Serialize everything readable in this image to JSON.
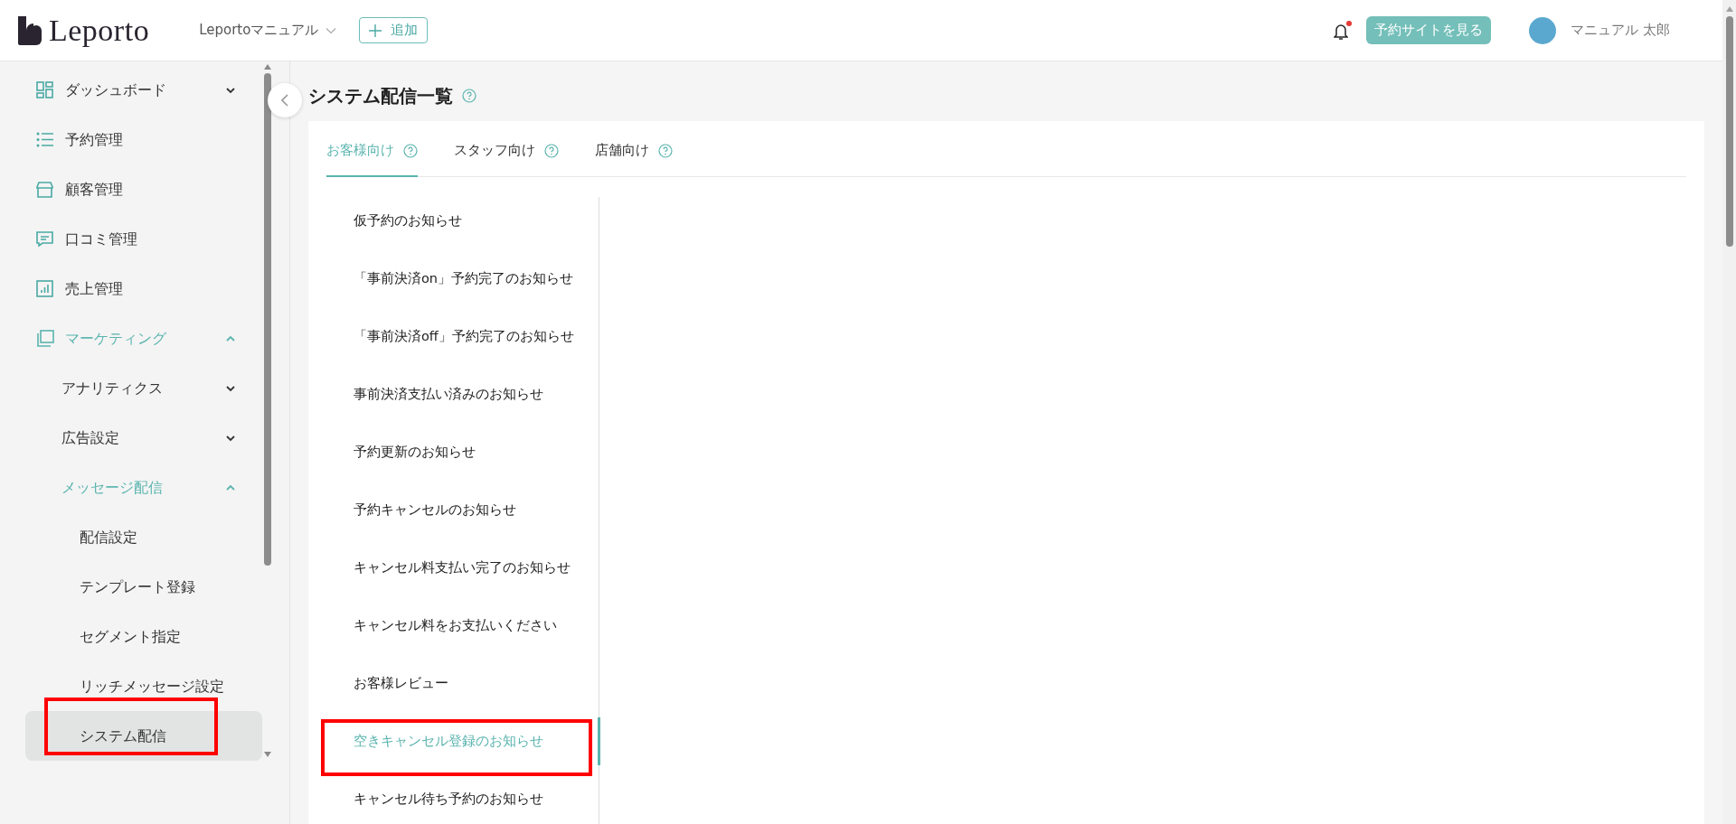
{
  "header": {
    "logo": "Leporto",
    "workspace": "Leportoマニュアル",
    "add_button": "追加",
    "notification_unread": true,
    "site_button": "予約サイトを見る",
    "user_name": "マニュアル 太郎"
  },
  "sidebar": {
    "items": [
      {
        "label": "ダッシュボード",
        "kind": "dashboard",
        "expanded": false,
        "highlighted": false
      },
      {
        "label": "予約管理",
        "kind": "list",
        "highlighted": false
      },
      {
        "label": "顧客管理",
        "kind": "store",
        "highlighted": false
      },
      {
        "label": "口コミ管理",
        "kind": "chat",
        "highlighted": false
      },
      {
        "label": "売上管理",
        "kind": "chart",
        "highlighted": false
      },
      {
        "label": "マーケティング",
        "kind": "pages",
        "expanded": true,
        "highlighted": false,
        "children": [
          {
            "label": "アナリティクス",
            "expanded": false,
            "highlighted": false
          },
          {
            "label": "広告設定",
            "expanded": false,
            "highlighted": false
          },
          {
            "label": "メッセージ配信",
            "expanded": true,
            "highlighted": false,
            "children": [
              {
                "label": "配信設定",
                "selected": false,
                "highlighted": false
              },
              {
                "label": "テンプレート登録",
                "selected": false,
                "highlighted": false
              },
              {
                "label": "セグメント指定",
                "selected": false,
                "highlighted": false
              },
              {
                "label": "リッチメッセージ設定",
                "selected": false,
                "highlighted": false
              },
              {
                "label": "システム配信",
                "selected": true,
                "highlighted": true
              }
            ]
          }
        ]
      }
    ]
  },
  "page": {
    "title": "システム配信一覧",
    "tabs": [
      {
        "label": "お客様向け",
        "selected": true
      },
      {
        "label": "スタッフ向け",
        "selected": false
      },
      {
        "label": "店舗向け",
        "selected": false
      }
    ],
    "messages": [
      {
        "label": "仮予約のお知らせ",
        "selected": false,
        "highlighted": false
      },
      {
        "label": "「事前決済on」予約完了のお知らせ",
        "selected": false,
        "highlighted": false
      },
      {
        "label": "「事前決済off」予約完了のお知らせ",
        "selected": false,
        "highlighted": false
      },
      {
        "label": "事前決済支払い済みのお知らせ",
        "selected": false,
        "highlighted": false
      },
      {
        "label": "予約更新のお知らせ",
        "selected": false,
        "highlighted": false
      },
      {
        "label": "予約キャンセルのお知らせ",
        "selected": false,
        "highlighted": false
      },
      {
        "label": "キャンセル料支払い完了のお知らせ",
        "selected": false,
        "highlighted": false
      },
      {
        "label": "キャンセル料をお支払いください",
        "selected": false,
        "highlighted": false
      },
      {
        "label": "お客様レビュー",
        "selected": false,
        "highlighted": false
      },
      {
        "label": "空きキャンセル登録のお知らせ",
        "selected": true,
        "highlighted": true
      },
      {
        "label": "キャンセル待ち予約のお知らせ",
        "selected": false,
        "highlighted": false
      }
    ]
  }
}
